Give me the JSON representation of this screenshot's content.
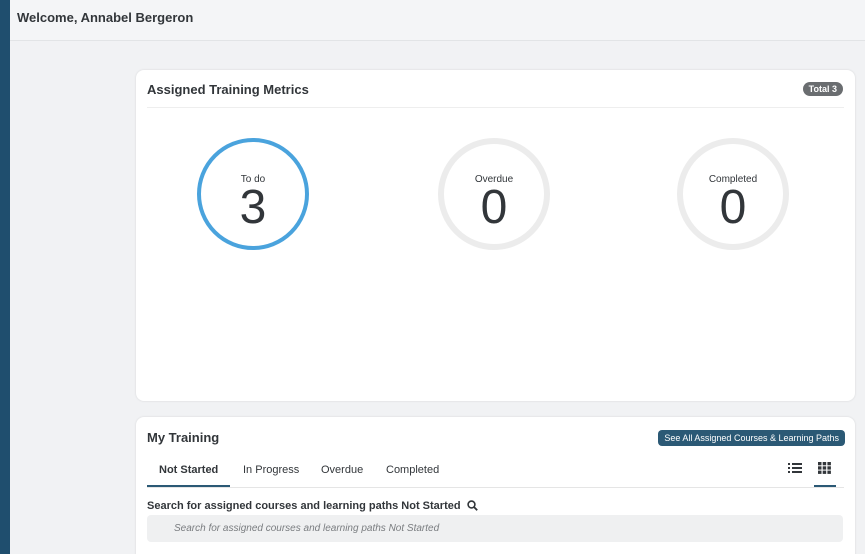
{
  "header": {
    "welcome": "Welcome, Annabel Bergeron"
  },
  "metrics": {
    "title": "Assigned Training Metrics",
    "total_badge": "Total 3",
    "rings": [
      {
        "label": "To do",
        "value": "3",
        "active": true
      },
      {
        "label": "Overdue",
        "value": "0",
        "active": false
      },
      {
        "label": "Completed",
        "value": "0",
        "active": false
      }
    ]
  },
  "training": {
    "title": "My Training",
    "see_all_label": "See All Assigned Courses & Learning Paths",
    "tabs": [
      {
        "label": "Not Started",
        "active": true
      },
      {
        "label": "In Progress",
        "active": false
      },
      {
        "label": "Overdue",
        "active": false
      },
      {
        "label": "Completed",
        "active": false
      }
    ],
    "view_icons": [
      "list-view-icon",
      "grid-view-icon"
    ],
    "search_label": "Search for assigned courses and learning paths Not Started",
    "search_placeholder": "Search for assigned courses and learning paths Not Started"
  },
  "colors": {
    "accent": "#4aa3dd",
    "primary_button": "#2b5975",
    "frame": "#1f4e6e",
    "badge": "#6a6d70"
  }
}
